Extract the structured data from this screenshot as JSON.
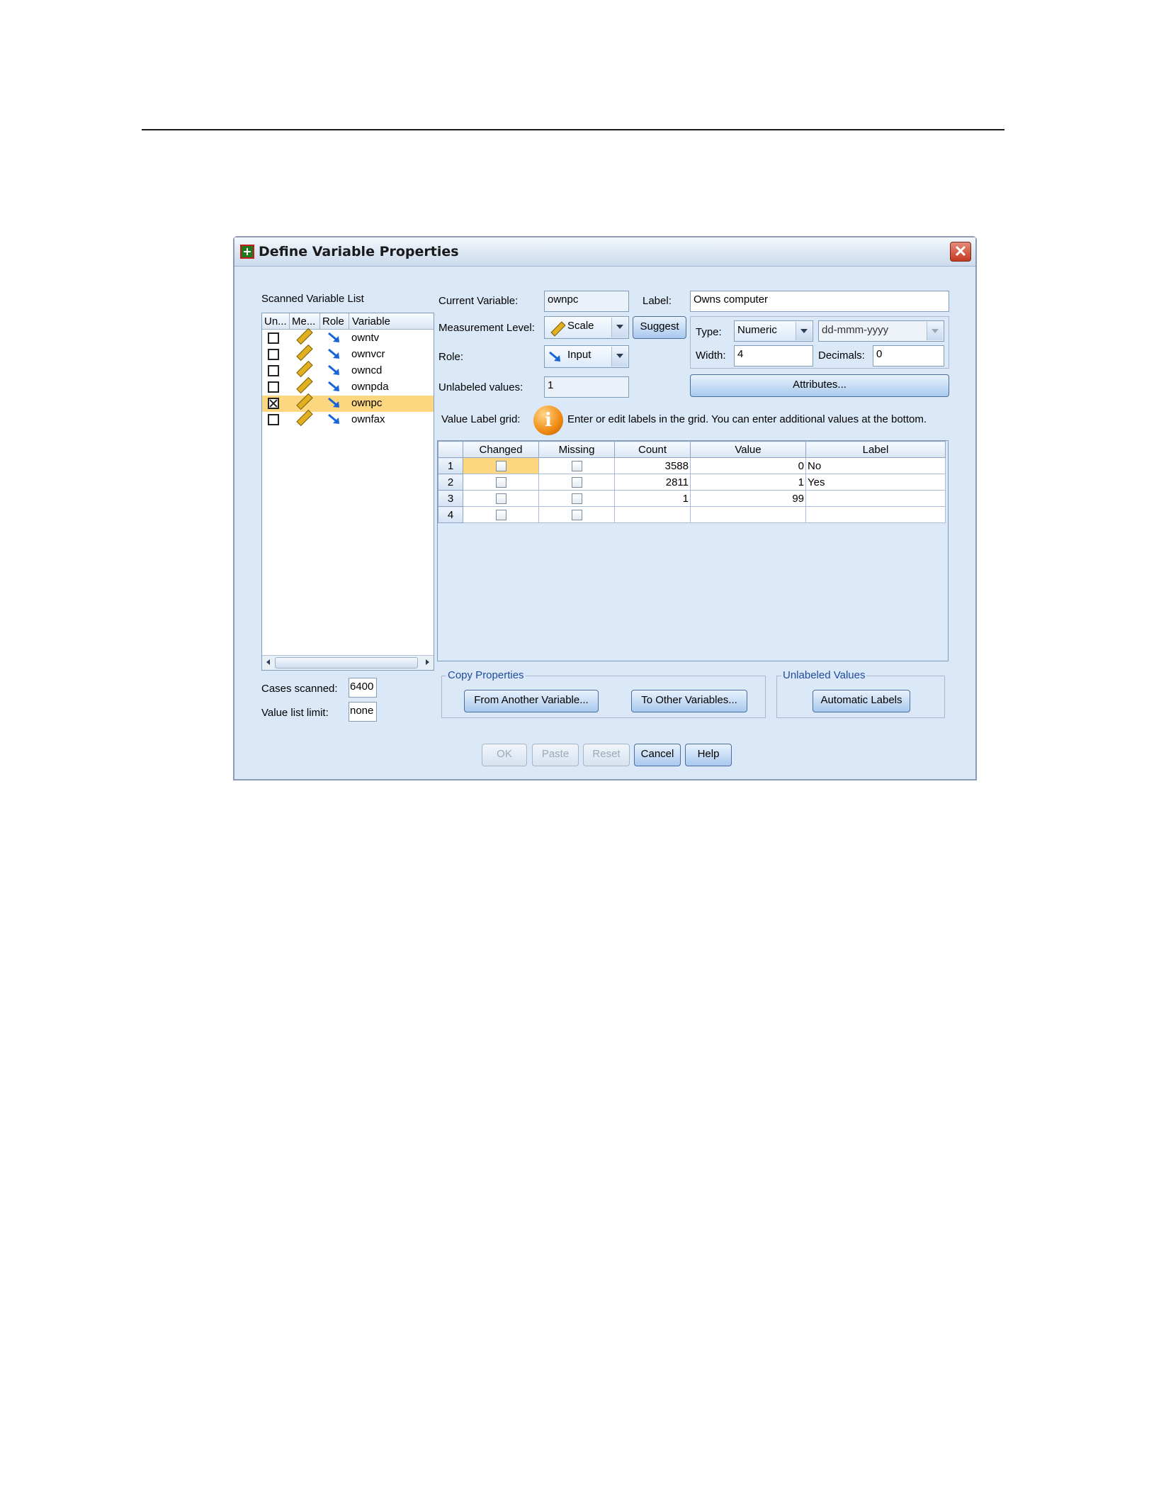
{
  "window": {
    "title": "Define Variable Properties",
    "close_glyph": "✕"
  },
  "scanned_list": {
    "label": "Scanned Variable List",
    "columns": [
      "Un...",
      "Me...",
      "Role",
      "Variable"
    ],
    "rows": [
      {
        "name": "owntv",
        "checked": false
      },
      {
        "name": "ownvcr",
        "checked": false
      },
      {
        "name": "owncd",
        "checked": false
      },
      {
        "name": "ownpda",
        "checked": false
      },
      {
        "name": "ownpc",
        "checked": true,
        "selected": true
      },
      {
        "name": "ownfax",
        "checked": false
      }
    ],
    "icons": {
      "measure": "ruler-icon",
      "role": "input-arrow-icon"
    }
  },
  "cases": {
    "label": "Cases scanned:",
    "value": "6400",
    "limit_label": "Value list limit:",
    "limit_value": "none"
  },
  "current": {
    "current_var_label": "Current Variable:",
    "current_var": "ownpc",
    "label_label": "Label:",
    "label_value": "Owns computer",
    "measure_label": "Measurement Level:",
    "measure_value": "Scale",
    "suggest": "Suggest",
    "role_label": "Role:",
    "role_value": "Input",
    "unlabeled_label": "Unlabeled values:",
    "unlabeled_value": "1",
    "type_label": "Type:",
    "type_value": "Numeric",
    "format_value": "dd-mmm-yyyy",
    "width_label": "Width:",
    "width_value": "4",
    "decimals_label": "Decimals:",
    "decimals_value": "0",
    "attributes": "Attributes..."
  },
  "grid": {
    "label": "Value Label grid:",
    "hint": "Enter or edit labels in the grid. You can enter additional values at the bottom.",
    "headers": [
      "Changed",
      "Missing",
      "Count",
      "Value",
      "Label"
    ],
    "rows": [
      {
        "n": "1",
        "count": "3588",
        "value": "0",
        "label": "No"
      },
      {
        "n": "2",
        "count": "2811",
        "value": "1",
        "label": "Yes"
      },
      {
        "n": "3",
        "count": "1",
        "value": "99",
        "label": ""
      },
      {
        "n": "4",
        "count": "",
        "value": "",
        "label": ""
      }
    ]
  },
  "copy": {
    "legend": "Copy Properties",
    "from": "From Another Variable...",
    "to": "To Other Variables..."
  },
  "unlabeled_group": {
    "legend": "Unlabeled Values",
    "auto": "Automatic Labels"
  },
  "buttons": {
    "ok": "OK",
    "paste": "Paste",
    "reset": "Reset",
    "cancel": "Cancel",
    "help": "Help"
  },
  "colors": {
    "selection": "#fdd780",
    "dialog_bg": "#dae8f8",
    "legend_text": "#1f4a9c"
  }
}
